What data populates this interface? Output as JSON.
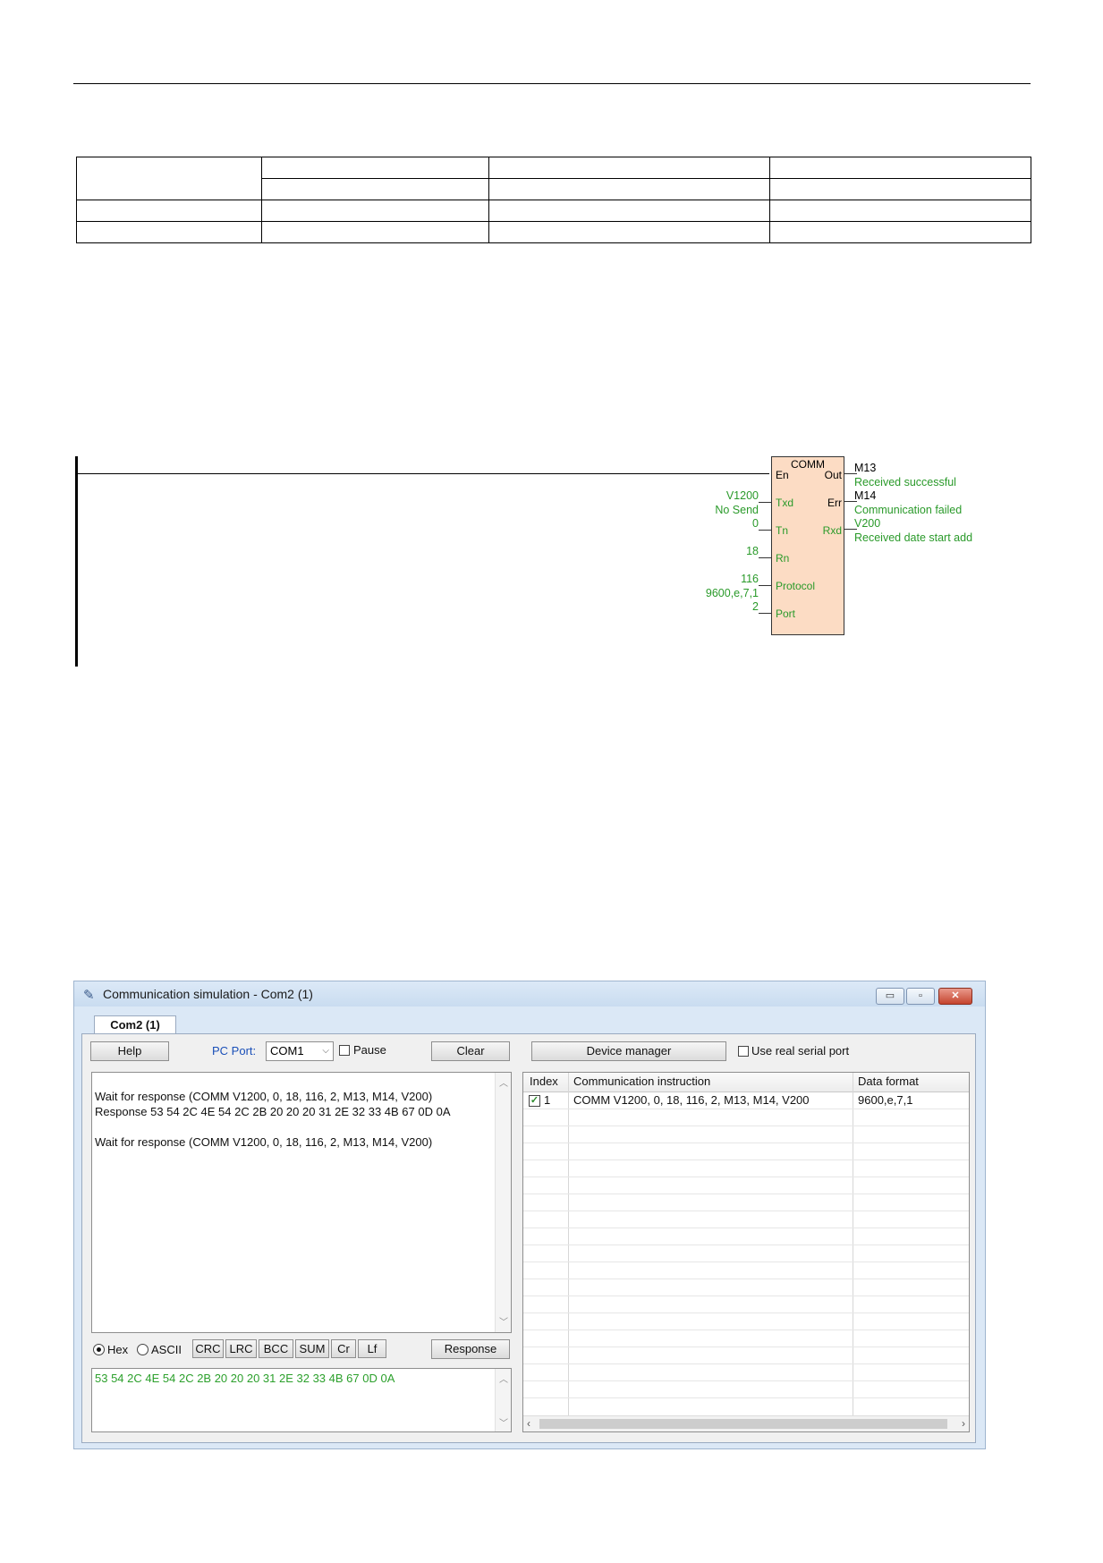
{
  "ladder": {
    "block_title": "COMM",
    "pins_left": {
      "en": "En",
      "txd": "Txd",
      "tn": "Tn",
      "rn": "Rn",
      "protocol": "Protocol",
      "port": "Port"
    },
    "pins_right": {
      "out": "Out",
      "err": "Err",
      "rxd": "Rxd"
    },
    "inputs": {
      "txd_value": "V1200",
      "txd_comment": "No Send",
      "tn_value": "0",
      "rn_value": "18",
      "protocol_value": "116",
      "protocol_comment": "9600,e,7,1",
      "port_value": "2"
    },
    "outputs": {
      "out_addr": "M13",
      "out_comment": "Received successful",
      "err_addr": "M14",
      "err_comment": "Communication failed",
      "rxd_addr": "V200",
      "rxd_comment": "Received date start  add"
    }
  },
  "window": {
    "title": "Communication simulation - Com2 (1)",
    "tab": "Com2 (1)",
    "help": "Help",
    "pc_port_label": "PC Port:",
    "pc_port_value": "COM1",
    "pause": "Pause",
    "clear": "Clear",
    "device_manager": "Device manager",
    "use_real": "Use real serial port",
    "log": [
      "Wait for response (COMM  V1200, 0, 18, 116, 2, M13, M14, V200)",
      "Response 53 54 2C 4E 54 2C 2B 20 20 20 31 2E 32 33 4B 67 0D 0A",
      "",
      "Wait for response (COMM  V1200, 0, 18, 116, 2, M13, M14, V200)"
    ],
    "hex": "Hex",
    "ascii": "ASCII",
    "tool_buttons": [
      "CRC",
      "LRC",
      "BCC",
      "SUM",
      "Cr",
      "Lf"
    ],
    "response_btn": "Response",
    "response_text": "53 54 2C 4E 54 2C 2B 20 20 20 31 2E 32 33 4B 67 0D 0A",
    "grid": {
      "columns": [
        "Index",
        "Communication instruction",
        "Data format"
      ],
      "rows": [
        {
          "checked": true,
          "index": "1",
          "instruction": "COMM  V1200, 0, 18, 116, 2, M13, M14, V200",
          "format": "9600,e,7,1"
        }
      ]
    }
  },
  "colors": {
    "label_green": "#2a9a2a",
    "block_fill": "#fcdcc4",
    "pc_port_blue": "#1a4fb8"
  }
}
